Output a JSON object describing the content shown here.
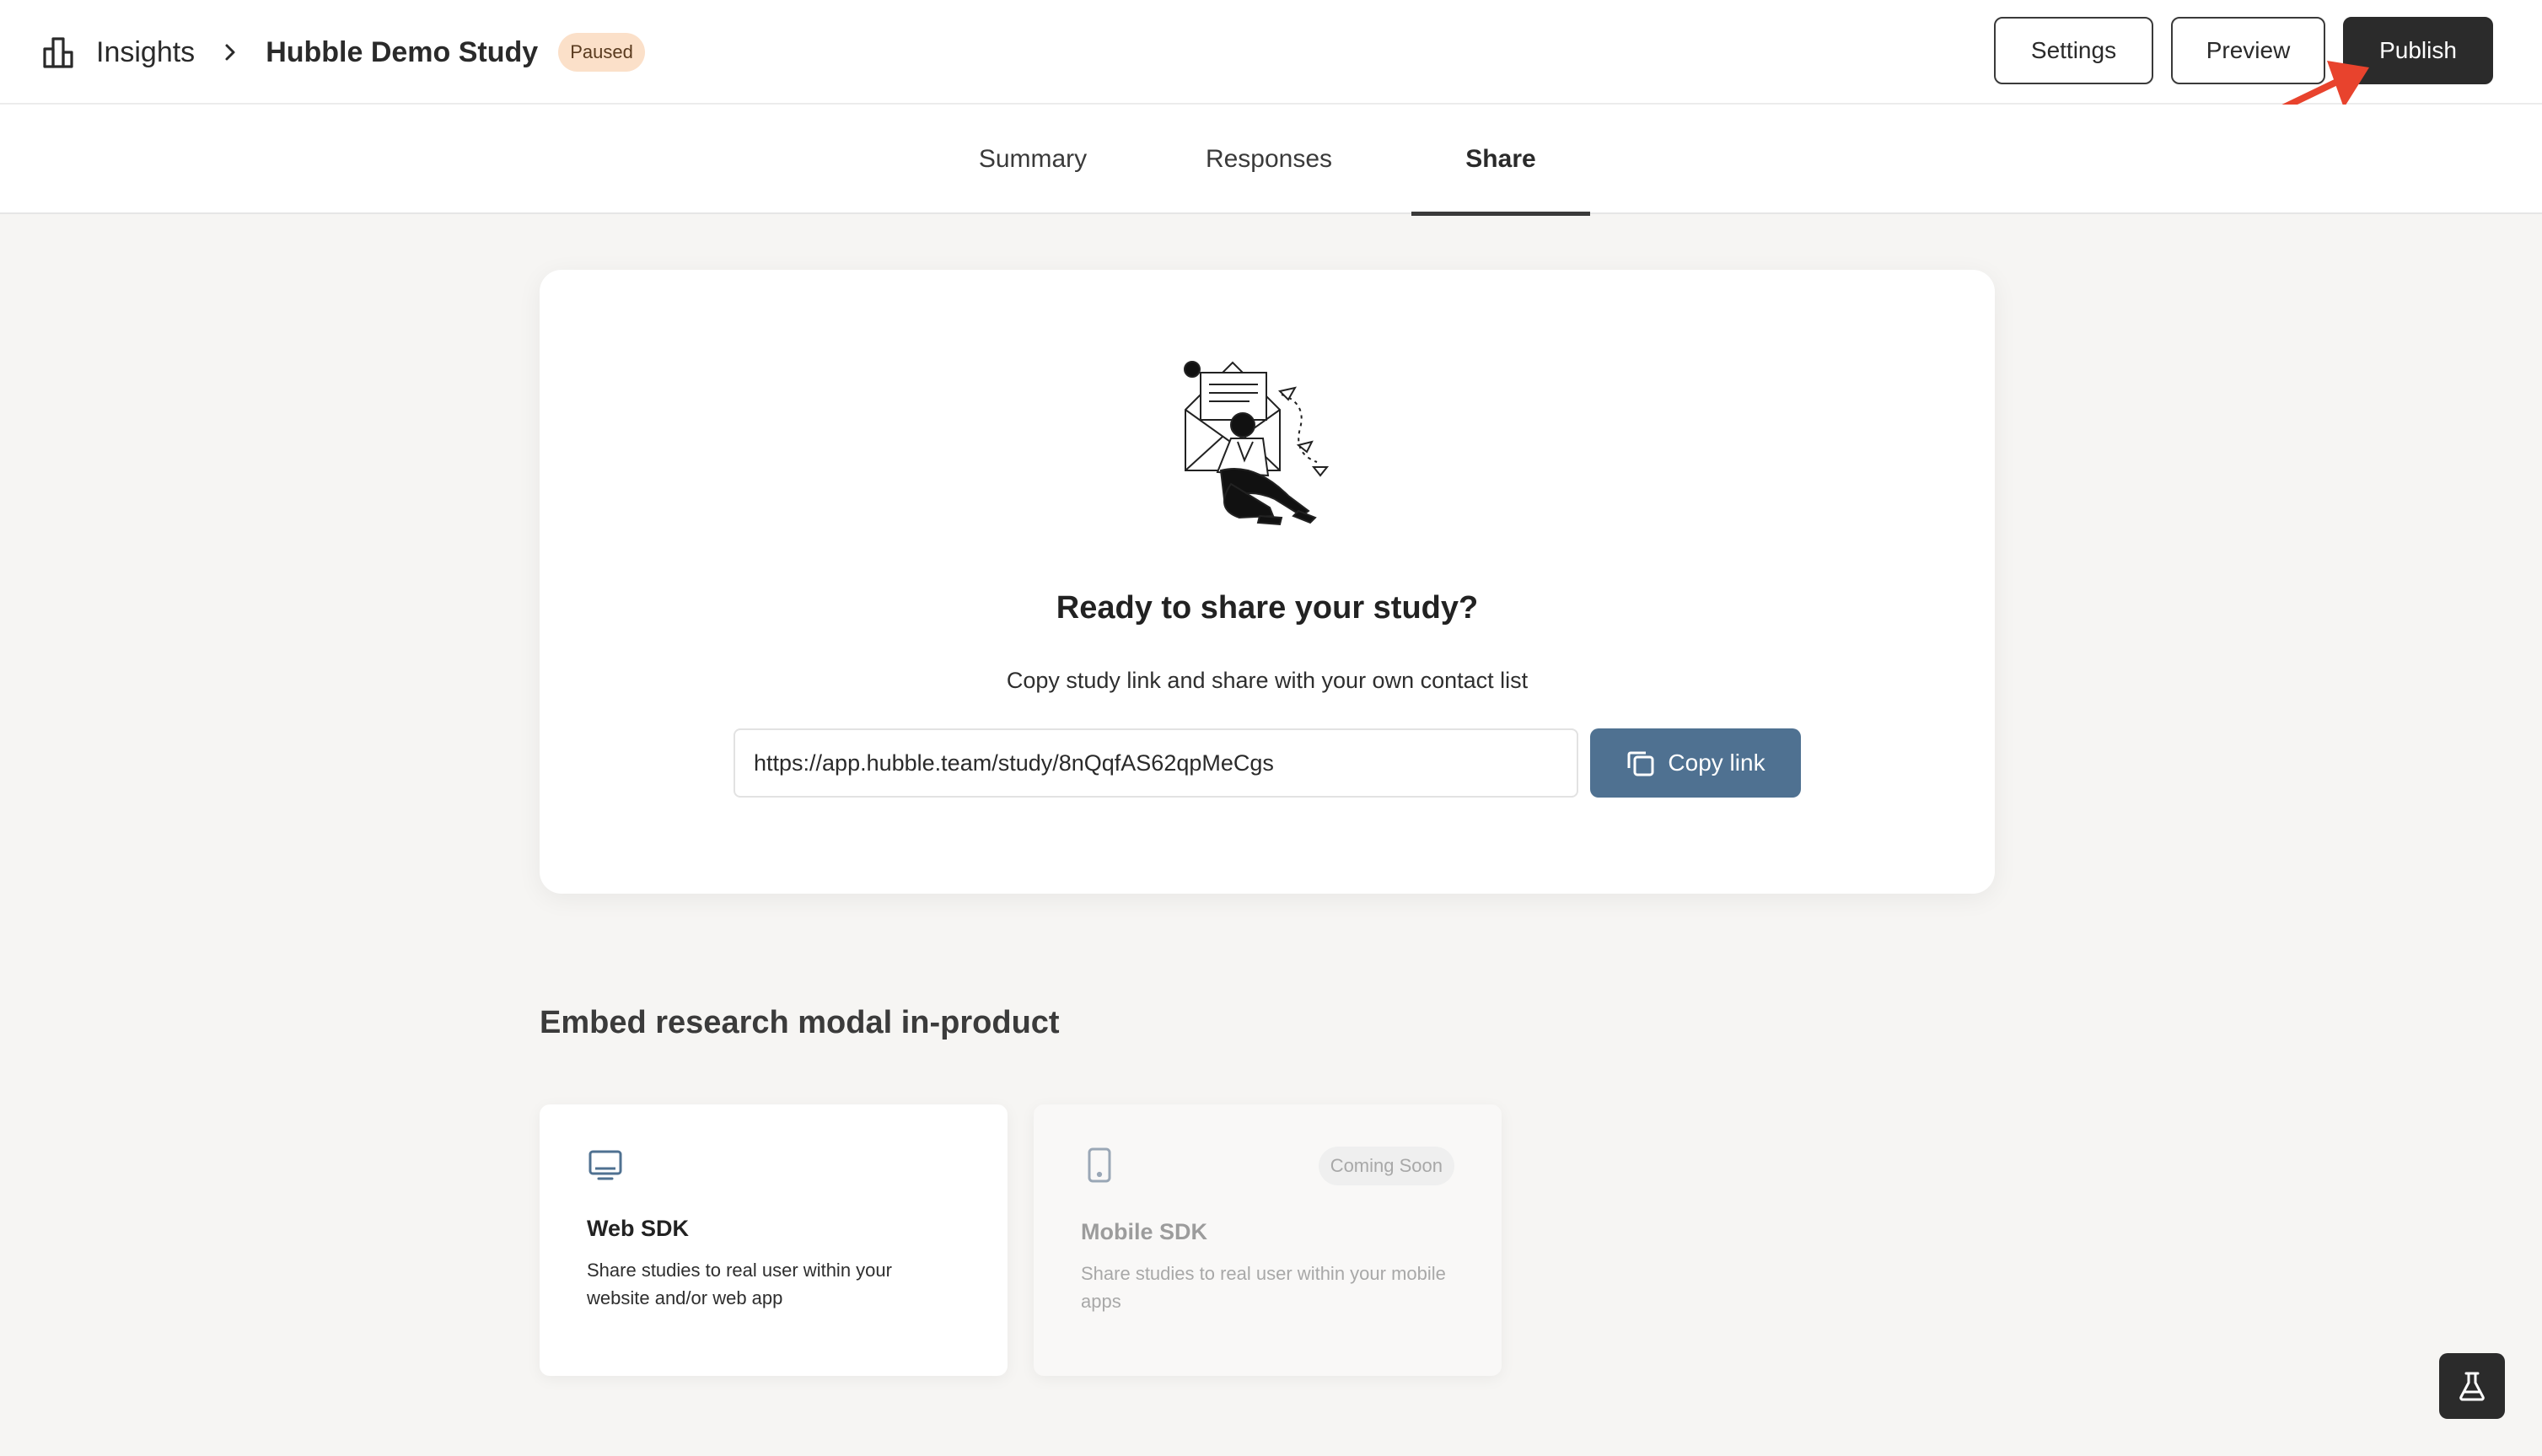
{
  "header": {
    "breadcrumb_root": "Insights",
    "breadcrumb_current": "Hubble Demo Study",
    "status_badge": "Paused",
    "settings_label": "Settings",
    "preview_label": "Preview",
    "publish_label": "Publish",
    "icons": {
      "root": "bar-chart-icon",
      "separator": "chevron-right-icon"
    }
  },
  "tabs": [
    {
      "label": "Summary",
      "active": false
    },
    {
      "label": "Responses",
      "active": false
    },
    {
      "label": "Share",
      "active": true
    }
  ],
  "share": {
    "title": "Ready to share your study?",
    "subtitle": "Copy study link and share with your own contact list",
    "link": "https://app.hubble.team/study/8nQqfAS62qpMeCgs",
    "copy_label": "Copy link",
    "copy_icon": "copy-icon"
  },
  "embed": {
    "title": "Embed research modal in-product",
    "cards": [
      {
        "icon": "monitor-icon",
        "title": "Web SDK",
        "description": "Share studies to real user within your website and/or web app"
      },
      {
        "icon": "mobile-phone-icon",
        "title": "Mobile SDK",
        "description": "Share studies to real user within your mobile apps",
        "badge": "Coming Soon"
      }
    ]
  },
  "colors": {
    "background": "#f6f5f3",
    "primary_dark": "#2b2b2b",
    "copy_button": "#4f7191",
    "paused_badge_bg": "#fbe0c9",
    "annotation_arrow": "#e8432d"
  },
  "fab_icon": "flask-icon"
}
